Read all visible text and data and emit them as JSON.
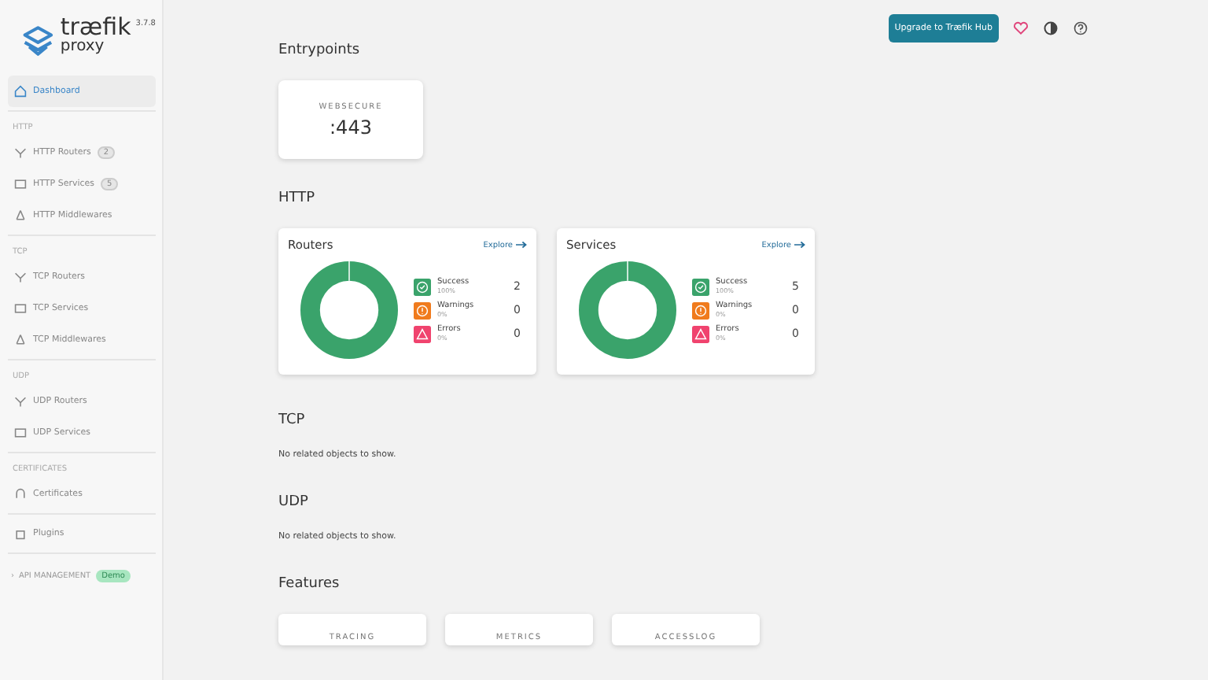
{
  "sidebar": {
    "logo": {
      "name": "træfik",
      "sub": "proxy",
      "version": "3.7.8"
    },
    "sections": [
      {
        "items": [
          {
            "label": "Dashboard",
            "kind": "home",
            "selected": true
          }
        ]
      },
      {
        "header": "HTTP",
        "items": [
          {
            "label": "HTTP Routers",
            "kind": "router",
            "badge": "2",
            "selected": false
          },
          {
            "label": "HTTP Services",
            "kind": "service",
            "badge": "5",
            "selected": false
          },
          {
            "label": "HTTP Middlewares",
            "kind": "middleware",
            "selected": false
          }
        ]
      },
      {
        "header": "TCP",
        "items": [
          {
            "label": "TCP Routers",
            "kind": "router",
            "selected": false
          },
          {
            "label": "TCP Services",
            "kind": "service",
            "selected": false
          },
          {
            "label": "TCP Middlewares",
            "kind": "middleware",
            "selected": false
          }
        ]
      },
      {
        "header": "UDP",
        "items": [
          {
            "label": "UDP Routers",
            "kind": "router",
            "selected": false
          },
          {
            "label": "UDP Services",
            "kind": "service",
            "selected": false
          }
        ]
      },
      {
        "header": "CERTIFICATES",
        "items": [
          {
            "label": "Certificates",
            "kind": "cert",
            "selected": false
          }
        ]
      },
      {
        "items": [
          {
            "label": "Plugins",
            "kind": "plugin",
            "selected": false
          }
        ]
      }
    ],
    "api": {
      "caret": "›",
      "label": "API MANAGEMENT",
      "badge": "Demo"
    }
  },
  "topbar": {
    "upgrade_button": "Upgrade to Træfik Hub"
  },
  "entrypoints": {
    "title": "Entrypoints",
    "items": [
      {
        "name": "WEBSECURE",
        "port": ":443"
      }
    ]
  },
  "http": {
    "title": "HTTP",
    "cards": [
      {
        "title": "Routers",
        "explore": "Explore",
        "stats": [
          {
            "kind": "success",
            "label": "Success",
            "percent": "100%",
            "count": "2"
          },
          {
            "kind": "warning",
            "label": "Warnings",
            "percent": "0%",
            "count": "0"
          },
          {
            "kind": "error",
            "label": "Errors",
            "percent": "0%",
            "count": "0"
          }
        ]
      },
      {
        "title": "Services",
        "explore": "Explore",
        "stats": [
          {
            "kind": "success",
            "label": "Success",
            "percent": "100%",
            "count": "5"
          },
          {
            "kind": "warning",
            "label": "Warnings",
            "percent": "0%",
            "count": "0"
          },
          {
            "kind": "error",
            "label": "Errors",
            "percent": "0%",
            "count": "0"
          }
        ]
      }
    ]
  },
  "tcp": {
    "title": "TCP",
    "empty": "No related objects to show."
  },
  "udp": {
    "title": "UDP",
    "empty": "No related objects to show."
  },
  "features": {
    "title": "Features",
    "items": [
      "TRACING",
      "METRICS",
      "ACCESSLOG"
    ]
  }
}
